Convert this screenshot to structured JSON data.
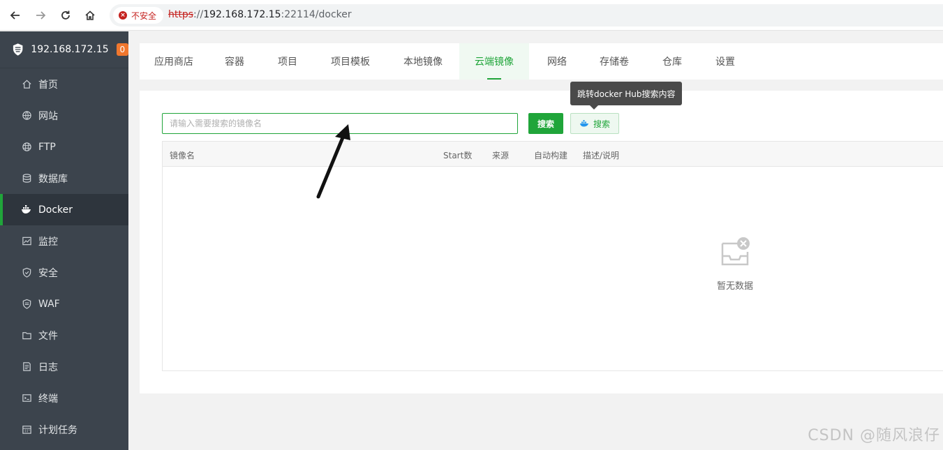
{
  "browser": {
    "insecure_label": "不安全",
    "url_scheme": "https",
    "url_sep": "://",
    "url_host": "192.168.172.15",
    "url_port_path": ":22114/docker"
  },
  "sidebar": {
    "host": "192.168.172.15",
    "badge": "0",
    "items": [
      {
        "label": "首页",
        "icon": "home-icon"
      },
      {
        "label": "网站",
        "icon": "globe-icon"
      },
      {
        "label": "FTP",
        "icon": "ftp-icon"
      },
      {
        "label": "数据库",
        "icon": "database-icon"
      },
      {
        "label": "Docker",
        "icon": "docker-icon",
        "active": true
      },
      {
        "label": "监控",
        "icon": "monitor-icon"
      },
      {
        "label": "安全",
        "icon": "shield-icon"
      },
      {
        "label": "WAF",
        "icon": "waf-icon"
      },
      {
        "label": "文件",
        "icon": "folder-icon"
      },
      {
        "label": "日志",
        "icon": "log-icon"
      },
      {
        "label": "终端",
        "icon": "terminal-icon"
      },
      {
        "label": "计划任务",
        "icon": "calendar-icon"
      }
    ]
  },
  "tabs": [
    {
      "label": "应用商店"
    },
    {
      "label": "容器"
    },
    {
      "label": "项目"
    },
    {
      "label": "项目模板"
    },
    {
      "label": "本地镜像"
    },
    {
      "label": "云端镜像",
      "active": true
    },
    {
      "label": "网络"
    },
    {
      "label": "存储卷"
    },
    {
      "label": "仓库"
    },
    {
      "label": "设置"
    }
  ],
  "search": {
    "placeholder": "请输入需要搜索的镜像名",
    "value": "",
    "button_label": "搜索",
    "hub_button_label": "搜索",
    "tooltip": "跳转docker Hub搜索内容"
  },
  "table": {
    "columns": [
      "镜像名",
      "Start数",
      "来源",
      "自动构建",
      "描述/说明"
    ],
    "rows": [],
    "empty_text": "暂无数据"
  },
  "watermark": "CSDN @随风浪仔",
  "colors": {
    "accent": "#20a53a",
    "sidebar_bg": "#3c444d",
    "badge": "#f0772e"
  }
}
